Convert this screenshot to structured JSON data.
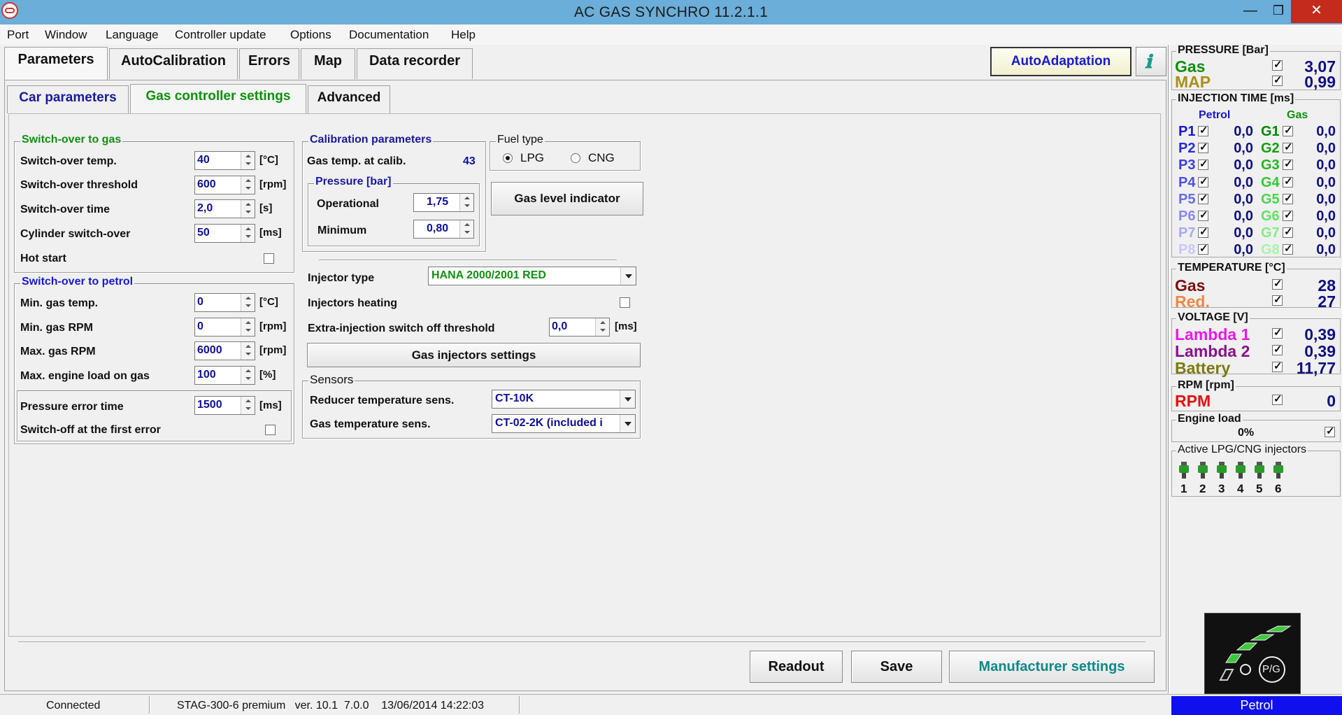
{
  "window": {
    "title": "AC GAS SYNCHRO  11.2.1.1"
  },
  "menu": [
    "Port",
    "Window",
    "Language",
    "Controller update",
    "Options",
    "Documentation",
    "Help"
  ],
  "tabs": [
    "Parameters",
    "AutoCalibration",
    "Errors",
    "Map",
    "Data recorder"
  ],
  "subtabs": [
    "Car parameters",
    "Gas controller settings",
    "Advanced"
  ],
  "autoadapt": "AutoAdaptation",
  "sw_gas": {
    "title": "Switch-over to gas",
    "rows": [
      {
        "label": "Switch-over temp.",
        "value": "40",
        "unit": "[°C]"
      },
      {
        "label": "Switch-over threshold",
        "value": "600",
        "unit": "[rpm]"
      },
      {
        "label": "Switch-over time",
        "value": "2,0",
        "unit": "[s]"
      },
      {
        "label": "Cylinder switch-over",
        "value": "50",
        "unit": "[ms]"
      }
    ],
    "hot_start": "Hot start"
  },
  "sw_petrol": {
    "title": "Switch-over to petrol",
    "rows": [
      {
        "label": "Min. gas temp.",
        "value": "0",
        "unit": "[°C]"
      },
      {
        "label": "Min. gas RPM",
        "value": "0",
        "unit": "[rpm]"
      },
      {
        "label": "Max. gas RPM",
        "value": "6000",
        "unit": "[rpm]"
      },
      {
        "label": "Max. engine load on gas",
        "value": "100",
        "unit": "[%]"
      }
    ],
    "pressure_error_time": "Pressure error time",
    "pressure_error_value": "1500",
    "pressure_error_unit": "[ms]",
    "switch_off_first": "Switch-off at the first error"
  },
  "calib": {
    "title": "Calibration parameters",
    "gas_temp_label": "Gas temp. at calib.",
    "gas_temp_value": "43",
    "pressure_title": "Pressure [bar]",
    "operational_label": "Operational",
    "operational_value": "1,75",
    "minimum_label": "Minimum",
    "minimum_value": "0,80"
  },
  "fuel": {
    "title": "Fuel type",
    "lpg": "LPG",
    "cng": "CNG"
  },
  "gas_level_btn": "Gas level indicator",
  "injector": {
    "type_label": "Injector type",
    "type_value": "HANA 2000/2001 RED",
    "heating_label": "Injectors heating",
    "extra_label": "Extra-injection switch off threshold",
    "extra_value": "0,0",
    "extra_unit": "[ms]",
    "settings_btn": "Gas injectors settings"
  },
  "sensors": {
    "title": "Sensors",
    "reducer_label": "Reducer temperature sens.",
    "reducer_value": "CT-10K",
    "gas_label": "Gas temperature sens.",
    "gas_value": "CT-02-2K (included i"
  },
  "buttons": {
    "readout": "Readout",
    "save": "Save",
    "manufacturer": "Manufacturer settings"
  },
  "status": {
    "connected": "Connected",
    "device": "STAG-300-6 premium   ver. 10.1  7.0.0    13/06/2014 14:22:03",
    "mode": "Petrol"
  },
  "side": {
    "pressure": {
      "title": "PRESSURE [Bar]",
      "gas_label": "Gas",
      "gas_value": "3,07",
      "map_label": "MAP",
      "map_value": "0,99"
    },
    "injection": {
      "title": "INJECTION TIME [ms]",
      "petrol": "Petrol",
      "gas": "Gas",
      "rows": [
        {
          "p": "P1",
          "pv": "0,0",
          "g": "G1",
          "gv": "0,0"
        },
        {
          "p": "P2",
          "pv": "0,0",
          "g": "G2",
          "gv": "0,0"
        },
        {
          "p": "P3",
          "pv": "0,0",
          "g": "G3",
          "gv": "0,0"
        },
        {
          "p": "P4",
          "pv": "0,0",
          "g": "G4",
          "gv": "0,0"
        },
        {
          "p": "P5",
          "pv": "0,0",
          "g": "G5",
          "gv": "0,0"
        },
        {
          "p": "P6",
          "pv": "0,0",
          "g": "G6",
          "gv": "0,0"
        },
        {
          "p": "P7",
          "pv": "0,0",
          "g": "G7",
          "gv": "0,0"
        },
        {
          "p": "P8",
          "pv": "0,0",
          "g": "G8",
          "gv": "0,0"
        }
      ]
    },
    "temperature": {
      "title": "TEMPERATURE [°C]",
      "gas_label": "Gas",
      "gas_value": "28",
      "red_label": "Red.",
      "red_value": "27"
    },
    "voltage": {
      "title": "VOLTAGE [V]",
      "l1_label": "Lambda 1",
      "l1_value": "0,39",
      "l2_label": "Lambda 2",
      "l2_value": "0,39",
      "bat_label": "Battery",
      "bat_value": "11,77"
    },
    "rpm": {
      "title": "RPM [rpm]",
      "label": "RPM",
      "value": "0"
    },
    "load": {
      "title": "Engine load",
      "value": "0%"
    },
    "active": {
      "title": "Active LPG/CNG injectors",
      "nums": [
        "1",
        "2",
        "3",
        "4",
        "5",
        "6"
      ]
    }
  },
  "colors": {
    "petrol": [
      "#1a1acc",
      "#2a2ad8",
      "#3c3ce0",
      "#5050e8",
      "#6a6aee",
      "#8888f2",
      "#a8a8f6",
      "#c8c8fa"
    ],
    "gas": [
      "#008a00",
      "#10a010",
      "#22b622",
      "#34c834",
      "#4ad64a",
      "#62e262",
      "#82ec82",
      "#a8f4a8"
    ]
  },
  "logo_text": "P/G"
}
